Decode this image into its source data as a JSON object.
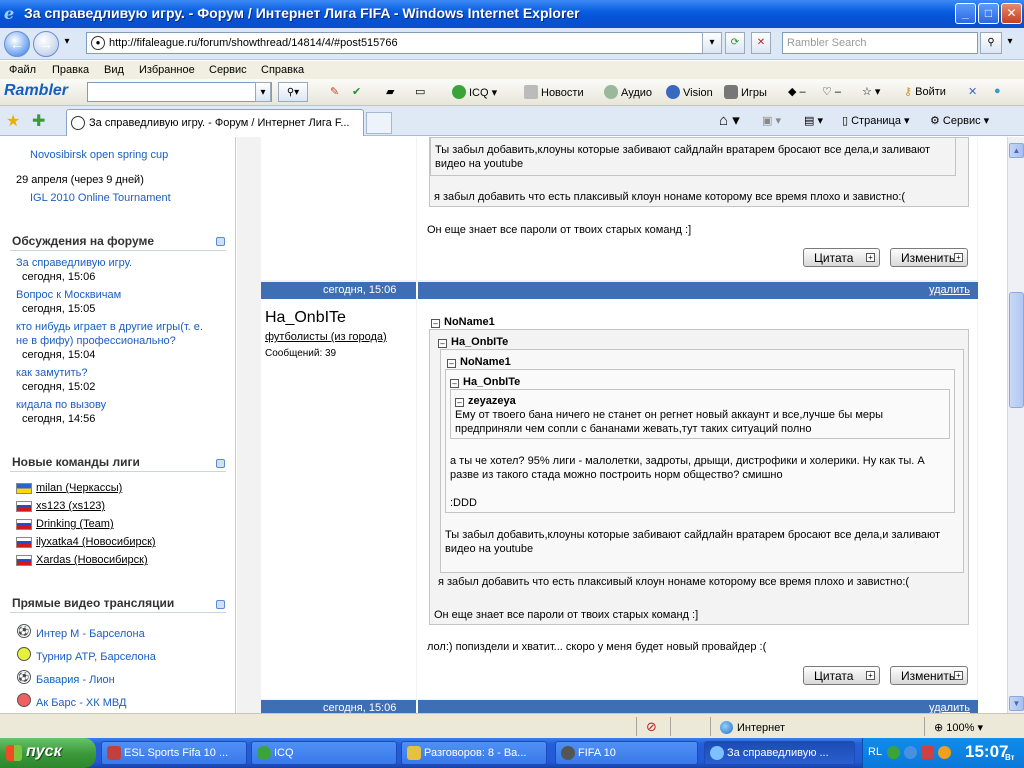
{
  "window": {
    "title": "За справедливую игру. - Форум / Интернет Лига FIFA - Windows Internet Explorer",
    "minimize": "_",
    "maximize": "□",
    "close": "✕"
  },
  "address_bar": {
    "url": "http://fifaleague.ru/forum/showthread/14814/4/#post515766",
    "search_placeholder": "Rambler Search"
  },
  "menu": [
    "Файл",
    "Правка",
    "Вид",
    "Избранное",
    "Сервис",
    "Справка"
  ],
  "rambler_toolbar": {
    "logo": "Rambler",
    "items": [
      "ICQ",
      "Новости",
      "Аудио",
      "Vision",
      "Игры",
      "Войти"
    ]
  },
  "tabs": {
    "active": "За справедливую игру. - Форум / Интернет Лига F...",
    "toolbar": {
      "page": "Страница",
      "service": "Сервис"
    }
  },
  "sidebar": {
    "events": [
      {
        "title": "Novosibirsk open spring cup"
      },
      {
        "date": "29 апреля (через 9 дней)",
        "title": "IGL 2010 Online Tournament"
      }
    ],
    "forum_section": {
      "heading": "Обсуждения на форуме",
      "topics": [
        {
          "title": "За справедливую игру.",
          "time": "сегодня, 15:06"
        },
        {
          "title": "Вопрос к Москвичам",
          "time": "сегодня, 15:05"
        },
        {
          "title_line1": "кто нибудь играет в другие игры(т. е.",
          "title_line2": "не в фифу) профессионально?",
          "time": "сегодня, 15:04"
        },
        {
          "title": "как замутить?",
          "time": "сегодня, 15:02"
        },
        {
          "title": "кидала по вызову",
          "time": "сегодня, 14:56"
        }
      ]
    },
    "teams_section": {
      "heading": "Новые команды лиги",
      "teams": [
        {
          "name": "milan (Черкассы)",
          "flag": "ua"
        },
        {
          "name": "xs123 (xs123)",
          "flag": "ru"
        },
        {
          "name": "Drinking (Team)",
          "flag": "ru"
        },
        {
          "name": "ilyxatka4 (Новосибирск)",
          "flag": "ru"
        },
        {
          "name": "Xardas (Новосибирск)",
          "flag": "ru"
        }
      ]
    },
    "video_section": {
      "heading": "Прямые видео трансляции",
      "streams": [
        {
          "title": "Интер М - Барселона",
          "icon": "football-icon"
        },
        {
          "title": "Турнир ATP, Барселона",
          "icon": "tennis-icon"
        },
        {
          "title": "Бавария - Лион",
          "icon": "football-icon"
        },
        {
          "title": "Ак Барс - ХК МВД",
          "icon": "hockey-icon"
        }
      ]
    }
  },
  "posts": {
    "top_post": {
      "quote_text_line1": "Ты забыл добавить,клоуны которые забивают сайдлайн вратарем бросают все дела,и заливают",
      "quote_text_line2": "видео на youtube",
      "line_after_quote": "я забыл добавить что есть плаксивый клоун нонаме которому все время плохо и завистно:(",
      "reply": "Он еще знает все пароли от твоих старых команд :]",
      "quote_btn": "Цитата",
      "edit_btn": "Изменить"
    },
    "post2": {
      "date": "сегодня, 15:06",
      "delete": "удалить",
      "author": "Ha_OnbITe",
      "group": "футболисты (из города)",
      "messages": "Сообщений: 39",
      "q1_name": "NoName1",
      "q2_name": "Ha_OnbITe",
      "q3_name": "NoName1",
      "q4_name": "Ha_OnbITe",
      "q5_name": "zeyazeya",
      "q5_line1": "Ему от твоего бана ничего не станет он регнет новый аккаунт и все,лучше бы меры",
      "q5_line2": "предприняли чем сопли с бананами жевать,тут таких ситуаций полно",
      "q4_line1": "а ты че хотел? 95% лиги - малолетки, задроты, дрыщи, дистрофики и холерики. Ну как ты. А",
      "q4_line2": "разве из такого стада можно построить норм общество? смишно",
      "q4_line3": ":DDD",
      "q3_line1": "Ты забыл добавить,клоуны которые забивают сайдлайн вратарем бросают все дела,и заливают",
      "q3_line2": "видео на youtube",
      "q2_line1": "я забыл добавить что есть плаксивый клоун нонаме которому все время плохо и завистно:(",
      "q1_line1": "Он еще знает все пароли от твоих старых команд :]",
      "reply": "лол:) попиздели и хватит... скоро у меня будет новый провайдер :(",
      "quote_btn": "Цитата",
      "edit_btn": "Изменить"
    },
    "post3": {
      "date": "сегодня, 15:06",
      "delete": "удалить"
    }
  },
  "status_bar": {
    "zone": "Интернет",
    "zoom": "100%"
  },
  "taskbar": {
    "start": "пуск",
    "tasks": [
      {
        "label": "ESL Sports Fifa 10 ..."
      },
      {
        "label": "ICQ"
      },
      {
        "label": "Разговоров: 8 - Ва..."
      },
      {
        "label": "FIFA 10"
      },
      {
        "label": "За справедливую ..."
      }
    ],
    "lang": "RL",
    "clock": "15:07",
    "day": "Вт"
  },
  "colors": {
    "header_bar": "#3e6fb4",
    "link": "#1a5ec2",
    "taskbar": "#245edb"
  }
}
